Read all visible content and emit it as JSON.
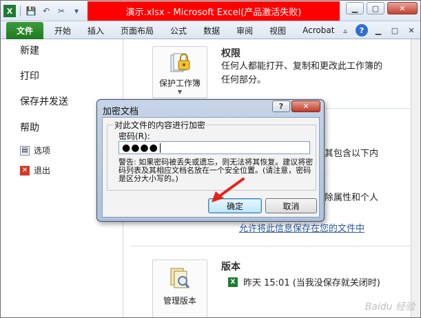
{
  "window": {
    "title": "演示.xlsx - Microsoft Excel(产品激活失败)"
  },
  "ribbon": {
    "file_tab": "文件",
    "tabs": [
      "开始",
      "插入",
      "页面布局",
      "公式",
      "数据",
      "审阅",
      "视图",
      "Acrobat"
    ]
  },
  "nav": {
    "items": [
      "新建",
      "打印",
      "保存并发送",
      "帮助"
    ],
    "options": "选项",
    "exit": "退出"
  },
  "content": {
    "protect_button": "保护工作簿",
    "permissions_title": "权限",
    "permissions_text_1": "任何人都能打开、复制和更改此工作簿的",
    "permissions_text_2": "任何部分。",
    "inspect_text": "其包含以下内",
    "doc_props_text": "除属性和个人",
    "allow_link": "允许将此信息保存在您的文件中",
    "version_title": "版本",
    "version_entry": "昨天 15:01 (当我没保存就关闭时)",
    "manage_versions": "管理版本"
  },
  "dialog": {
    "title": "加密文档",
    "group_label": "对此文件的内容进行加密",
    "password_label": "密码(R):",
    "password_value": "●●●●",
    "warning": "警告: 如果密码被丢失或遗忘，则无法将其恢复。建议将密码列表及其相应文档名放在一个安全位置。(请注意，密码是区分大小写的。)",
    "ok_label": "确定",
    "cancel_label": "取消",
    "help_btn": "?",
    "close_btn": "✕"
  },
  "watermark": "Baidu 经验"
}
